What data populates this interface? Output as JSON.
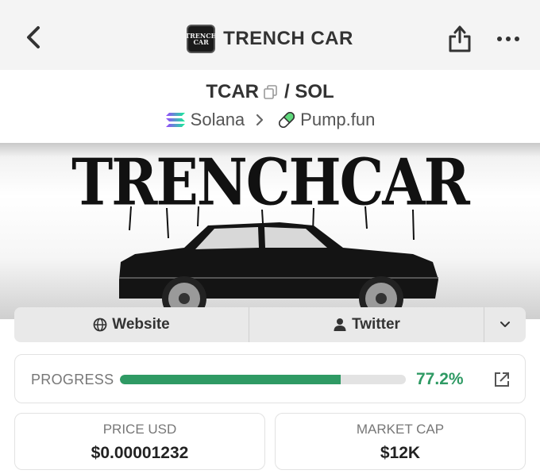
{
  "header": {
    "title": "TRENCH CAR",
    "logo_text": "TRENCH CAR",
    "icons": {
      "back": "chevron-left-icon",
      "share": "share-icon",
      "more": "more-dots-icon"
    }
  },
  "pair": {
    "base": "TCAR",
    "separator": "/",
    "quote": "SOL"
  },
  "chain": {
    "network": "Solana",
    "dex": "Pump.fun"
  },
  "banner": {
    "text": "TRENCHCAR"
  },
  "links": {
    "website_label": "Website",
    "twitter_label": "Twitter"
  },
  "progress": {
    "label": "PROGRESS",
    "value_text": "77.2%",
    "fraction": 0.772,
    "color": "#2f9a64"
  },
  "stats": {
    "price_label": "PRICE USD",
    "price_value": "$0.00001232",
    "mcap_label": "MARKET CAP",
    "mcap_value": "$12K"
  }
}
